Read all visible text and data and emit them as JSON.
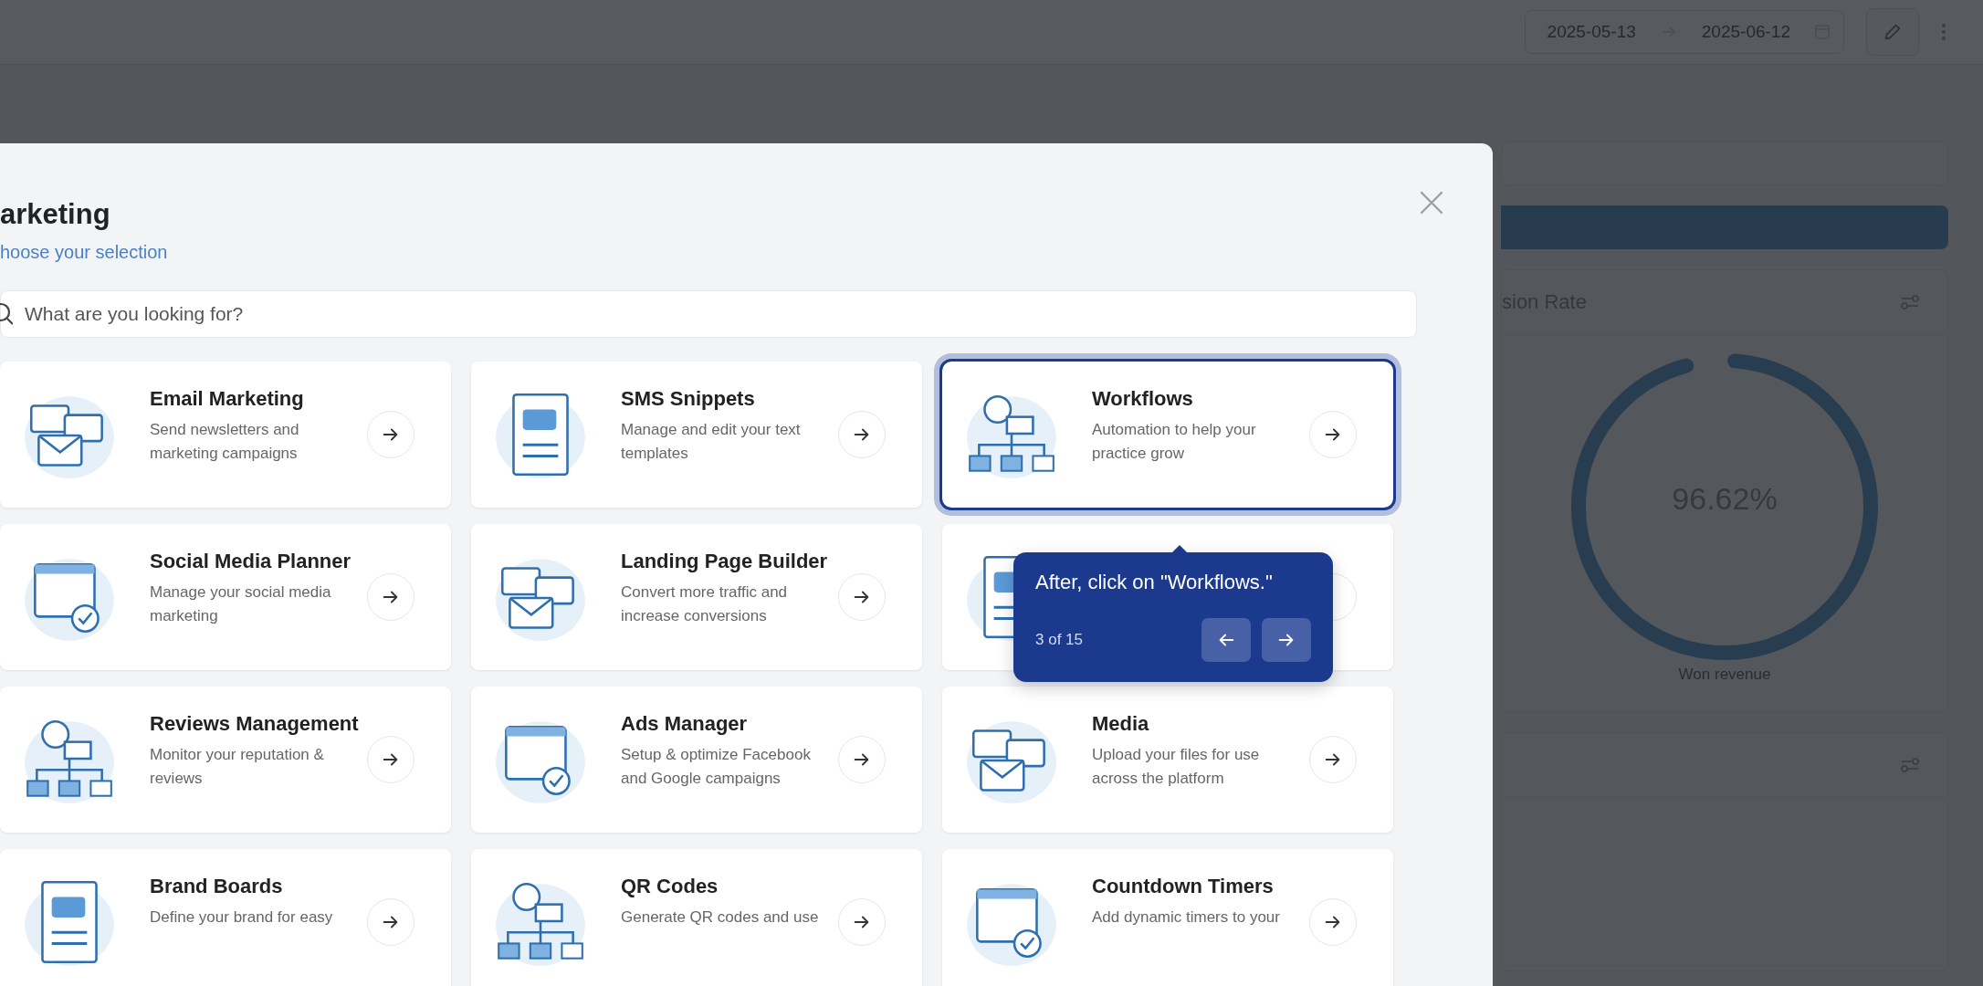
{
  "top_bar": {
    "date_from": "2025-05-13",
    "date_to": "2025-06-12"
  },
  "background": {
    "card_title": "sion Rate",
    "gauge": {
      "level": 0.9662,
      "reading": "96.62%",
      "label": "Won revenue"
    }
  },
  "modal": {
    "title": "arketing",
    "subtitle": "hoose your selection",
    "search": {
      "placeholder": "What are you looking for?"
    },
    "cards": [
      {
        "title": "Email Marketing",
        "description": "Send newsletters and marketing campaigns",
        "selected": false
      },
      {
        "title": "SMS Snippets",
        "description": "Manage and edit your text templates",
        "selected": false
      },
      {
        "title": "Workflows",
        "description": "Automation to help your practice grow",
        "selected": true
      },
      {
        "title": "Social Media Planner",
        "description": "Manage your social media marketing",
        "selected": false
      },
      {
        "title": "Landing Page Builder",
        "description": "Convert more traffic and increase conversions",
        "selected": false
      },
      {
        "selected": false
      },
      {
        "title": "Reviews Management",
        "description": "Monitor your reputation & reviews",
        "selected": false
      },
      {
        "title": "Ads Manager",
        "description": "Setup & optimize Facebook and Google campaigns",
        "selected": false
      },
      {
        "title": "Media",
        "description": "Upload your files for use across the platform",
        "selected": false
      },
      {
        "title": "Brand Boards",
        "description": "Define your brand for easy",
        "selected": false
      },
      {
        "title": "QR Codes",
        "description": "Generate QR codes and use",
        "selected": false
      },
      {
        "title": "Countdown Timers",
        "description": "Add dynamic timers to your",
        "selected": false
      }
    ]
  },
  "tour_tooltip": {
    "message": "After, click on \"Workflows.\"",
    "step": "3 of 15"
  }
}
